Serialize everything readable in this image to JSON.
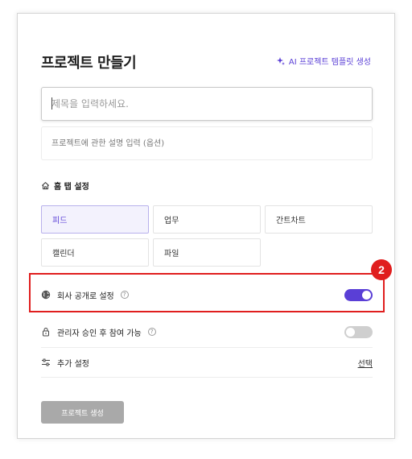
{
  "dialog": {
    "title": "프로젝트 만들기",
    "ai_link_label": "AI 프로젝트 템플릿 생성",
    "title_placeholder": "제목을 입력하세요.",
    "desc_placeholder": "프로젝트에 관한 설명 입력 (옵션)"
  },
  "home_tab": {
    "section_label": "홈 탭 설정",
    "options": [
      "피드",
      "업무",
      "간트차트",
      "캘린더",
      "파일"
    ],
    "selected": "피드"
  },
  "settings": {
    "company_public_label": "회사 공개로 설정",
    "company_public_on": true,
    "admin_approval_label": "관리자 승인 후 참여 가능",
    "admin_approval_on": false,
    "extra_label": "추가 설정",
    "extra_action": "선택"
  },
  "step_badge": "2",
  "create_button": "프로젝트 생성",
  "colors": {
    "accent": "#5a3fd6",
    "highlight": "#e01e1e",
    "disabled_button": "#a9a9a9"
  }
}
